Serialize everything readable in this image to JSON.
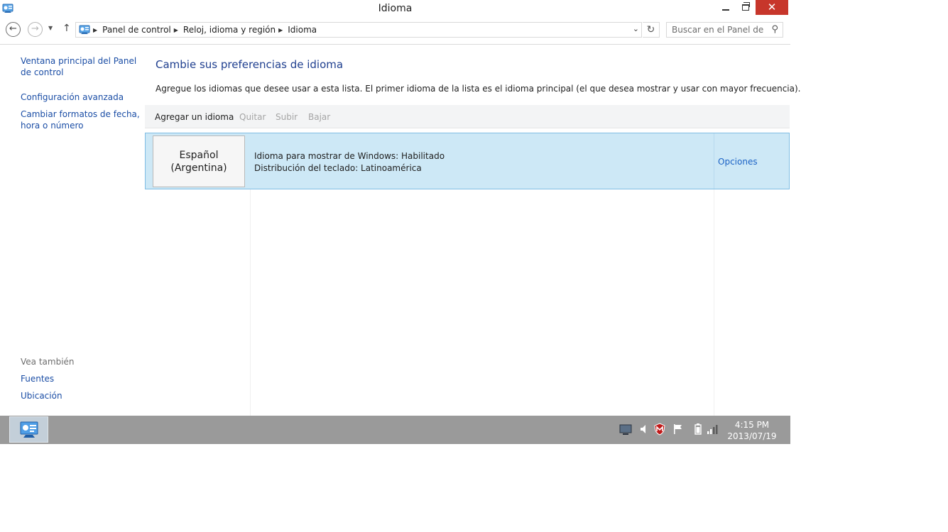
{
  "window": {
    "title": "Idioma"
  },
  "address": {
    "breadcrumbs": [
      "Panel de control",
      "Reloj, idioma y región",
      "Idioma"
    ],
    "search_placeholder": "Buscar en el Panel de ..."
  },
  "left_pane": {
    "links": [
      "Ventana principal del Panel de control",
      "Configuración avanzada",
      "Cambiar formatos de fecha, hora o número"
    ],
    "see_also_label": "Vea también",
    "see_also_links": [
      "Fuentes",
      "Ubicación"
    ]
  },
  "main": {
    "title": "Cambie sus preferencias de idioma",
    "description": "Agregue los idiomas que desee usar a esta lista. El primer idioma de la lista es el idioma principal (el que desea mostrar y usar con mayor frecuencia).",
    "toolbar": {
      "add": "Agregar un idioma",
      "remove": "Quitar",
      "move_up": "Subir",
      "move_down": "Bajar"
    },
    "languages": [
      {
        "name_line1": "Español",
        "name_line2": "(Argentina)",
        "display_status": "Idioma para mostrar de Windows: Habilitado",
        "keyboard": "Distribución del teclado: Latinoamérica",
        "options": "Opciones"
      }
    ]
  },
  "taskbar": {
    "time": "4:15 PM",
    "date": "2013/07/19",
    "tray_icons": [
      "display-icon",
      "volume-icon",
      "mcafee-shield-icon",
      "action-center-flag-icon",
      "battery-icon",
      "network-signal-icon"
    ]
  },
  "colors": {
    "close_button": "#c7362b",
    "link": "#1a4da5",
    "title": "#1f3f8f",
    "selected_row": "#cde8f6",
    "taskbar": "#9a9a9a"
  }
}
